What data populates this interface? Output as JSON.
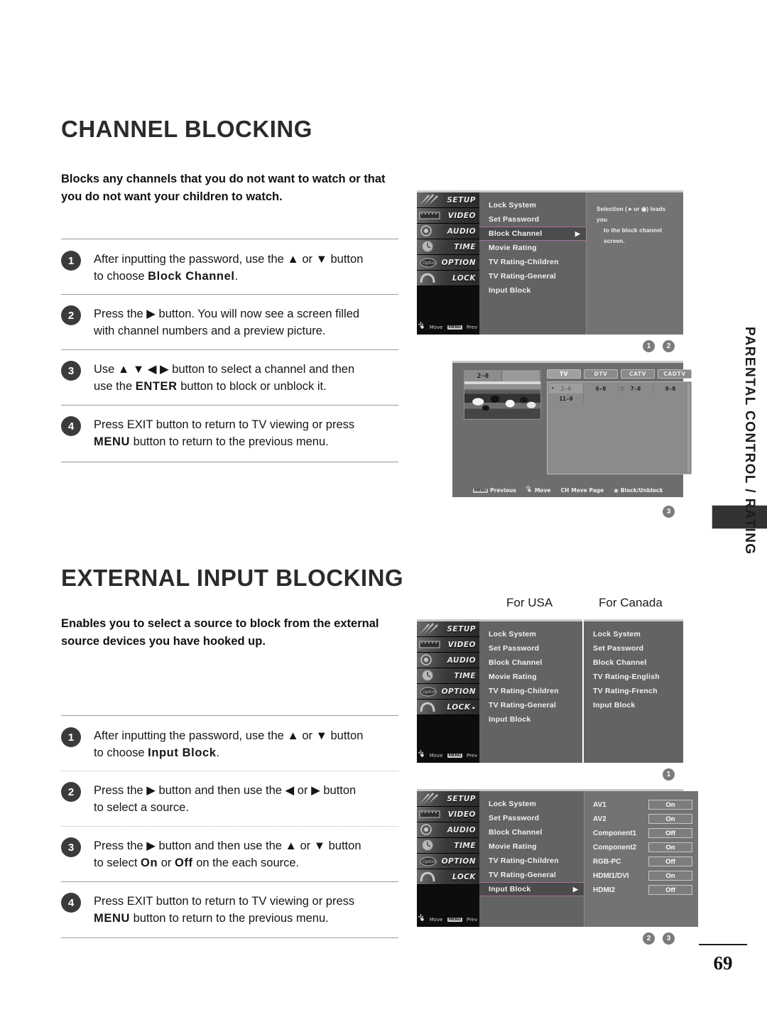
{
  "sections": [
    {
      "title": "CHANNEL BLOCKING",
      "intro": "Blocks any channels that you do not want to watch or that you do not want your children to watch.",
      "steps": [
        {
          "num": "1",
          "line1_a": "After inputting the password, use the ▲ or ▼ button",
          "line2_a": "to choose ",
          "line2_b": "Block Channel",
          "line2_c": "."
        },
        {
          "num": "2",
          "line1_a": "Press the ▶ button. You will now see a screen filled",
          "line2_a": "with channel numbers and a preview picture.",
          "line2_b": "",
          "line2_c": ""
        },
        {
          "num": "3",
          "line1_a": "Use ▲ ▼ ◀ ▶ button to select a channel and then",
          "line2_a": "use the ",
          "line2_b": "ENTER",
          "line2_c": " button to block or unblock it."
        },
        {
          "num": "4",
          "line1_a": "Press EXIT button to return to TV viewing or press",
          "line2_a": "",
          "line2_b": "MENU",
          "line2_c": " button to return to the previous menu."
        }
      ]
    },
    {
      "title": "EXTERNAL INPUT BLOCKING",
      "intro": "Enables you to select a source to block from the external source devices you have hooked up.",
      "steps": [
        {
          "num": "1",
          "line1_a": "After inputting the password, use the ▲ or ▼ button",
          "line2_a": "to choose ",
          "line2_b": "Input Block",
          "line2_c": "."
        },
        {
          "num": "2",
          "line1_a": "Press the ▶ button and then use the ◀ or ▶ button",
          "line2_a": "to select a source.",
          "line2_b": "",
          "line2_c": ""
        },
        {
          "num": "3",
          "line1_a": "Press the ▶ button and then use the ▲ or ▼ button",
          "line2_a": "to select ",
          "line2_b": "On",
          "line2_c": " or ",
          "line2_d": "Off",
          "line2_e": " on the each source."
        },
        {
          "num": "4",
          "line1_a": "Press EXIT button to return to TV viewing or press",
          "line2_a": "",
          "line2_b": "MENU",
          "line2_c": " button to return to the previous menu."
        }
      ]
    }
  ],
  "osd_sidebar": {
    "items": [
      {
        "label": "SETUP",
        "selected": false
      },
      {
        "label": "VIDEO",
        "selected": false
      },
      {
        "label": "AUDIO",
        "selected": false
      },
      {
        "label": "TIME",
        "selected": false
      },
      {
        "label": "OPTION",
        "selected": false
      },
      {
        "label": "LOCK",
        "selected": false
      }
    ],
    "hint_move": "Move",
    "hint_prev_key": "MENU",
    "hint_prev": "Prev"
  },
  "osd_sidebar_usa": {
    "items": [
      {
        "label": "SETUP",
        "selected": false
      },
      {
        "label": "VIDEO",
        "selected": false
      },
      {
        "label": "AUDIO",
        "selected": false
      },
      {
        "label": "TIME",
        "selected": false
      },
      {
        "label": "OPTION",
        "selected": false
      },
      {
        "label": "LOCK",
        "selected": true
      }
    ]
  },
  "osd_block_channel": {
    "menu": [
      {
        "label": "Lock System",
        "selected": false,
        "arrow": ""
      },
      {
        "label": "Set Password",
        "selected": false,
        "arrow": ""
      },
      {
        "label": "Block Channel",
        "selected": true,
        "arrow": "▶"
      },
      {
        "label": "Movie Rating",
        "selected": false,
        "arrow": ""
      },
      {
        "label": "TV Rating-Children",
        "selected": false,
        "arrow": ""
      },
      {
        "label": "TV Rating-General",
        "selected": false,
        "arrow": ""
      },
      {
        "label": "Input Block",
        "selected": false,
        "arrow": ""
      }
    ],
    "note_line1": "Selection ( ▸ or ◉) leads you",
    "note_line2": "to the block channel screen."
  },
  "channel_screen": {
    "preview_channel": "2-0",
    "tabs": [
      {
        "label": "TV",
        "selected": true
      },
      {
        "label": "DTV",
        "selected": false
      },
      {
        "label": "CATV",
        "selected": false
      },
      {
        "label": "CADTV",
        "selected": false
      }
    ],
    "channels": [
      {
        "num": "2-0",
        "selected": true,
        "prefix": "•"
      },
      {
        "num": "6-0",
        "selected": false,
        "prefix": ""
      },
      {
        "num": "7-0",
        "selected": false,
        "prefix": "□"
      },
      {
        "num": "9-0",
        "selected": false,
        "prefix": ""
      },
      {
        "num": "11-0",
        "selected": false,
        "prefix": ""
      }
    ],
    "hints": [
      {
        "key": "MENU",
        "label": "Previous"
      },
      {
        "key": "",
        "label": "Move"
      },
      {
        "key": "CH",
        "label": "Move Page"
      },
      {
        "key": "",
        "label": "Block/Unblock"
      }
    ]
  },
  "region_captions": {
    "usa": "For USA",
    "canada": "For Canada"
  },
  "osd_usa_menu": [
    {
      "label": "Lock System"
    },
    {
      "label": "Set Password"
    },
    {
      "label": "Block Channel"
    },
    {
      "label": "Movie Rating"
    },
    {
      "label": "TV Rating-Children"
    },
    {
      "label": "TV Rating-General"
    },
    {
      "label": "Input Block"
    }
  ],
  "osd_canada_menu": [
    {
      "label": "Lock System"
    },
    {
      "label": "Set Password"
    },
    {
      "label": "Block Channel"
    },
    {
      "label": "TV Rating-English"
    },
    {
      "label": "TV Rating-French"
    },
    {
      "label": "Input Block"
    }
  ],
  "osd_input_block": {
    "menu": [
      {
        "label": "Lock System",
        "selected": false,
        "arrow": ""
      },
      {
        "label": "Set Password",
        "selected": false,
        "arrow": ""
      },
      {
        "label": "Block Channel",
        "selected": false,
        "arrow": ""
      },
      {
        "label": "Movie Rating",
        "selected": false,
        "arrow": ""
      },
      {
        "label": "TV Rating-Children",
        "selected": false,
        "arrow": ""
      },
      {
        "label": "TV Rating-General",
        "selected": false,
        "arrow": ""
      },
      {
        "label": "Input Block",
        "selected": true,
        "arrow": "▶"
      }
    ],
    "sources": [
      {
        "label": "AV1",
        "value": "On"
      },
      {
        "label": "AV2",
        "value": "On"
      },
      {
        "label": "Component1",
        "value": "Off"
      },
      {
        "label": "Component2",
        "value": "On"
      },
      {
        "label": "RGB-PC",
        "value": "Off"
      },
      {
        "label": "HDMI1/DVI",
        "value": "On"
      },
      {
        "label": "HDMI2",
        "value": "Off"
      }
    ]
  },
  "badges": {
    "panel1_a": "1",
    "panel1_b": "2",
    "panel2": "3",
    "panel3": "1",
    "panel4_a": "2",
    "panel4_b": "3"
  },
  "side_tab": "PARENTAL CONTROL / RATING",
  "page_number": "69"
}
